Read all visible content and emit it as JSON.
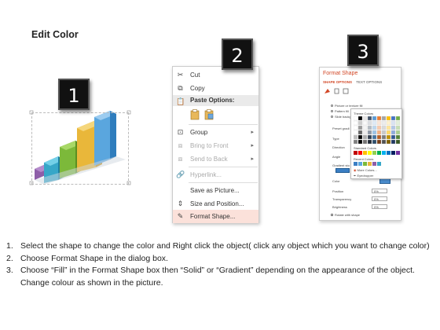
{
  "title": "Edit Color",
  "badges": [
    "1",
    "2",
    "3"
  ],
  "context_menu": {
    "items": [
      {
        "label": "Cut",
        "icon": "scissors-icon",
        "enabled": true
      },
      {
        "label": "Copy",
        "icon": "copy-icon",
        "enabled": true
      },
      {
        "label": "Paste Options:",
        "icon": "paste-icon",
        "enabled": true
      },
      {
        "label": "Group",
        "icon": "group-icon",
        "enabled": true,
        "submenu": true
      },
      {
        "label": "Bring to Front",
        "icon": "bring-to-front-icon",
        "enabled": false,
        "submenu": true
      },
      {
        "label": "Send to Back",
        "icon": "send-to-back-icon",
        "enabled": false,
        "submenu": true
      },
      {
        "label": "Hyperlink...",
        "icon": "hyperlink-icon",
        "enabled": false
      },
      {
        "label": "Save as Picture...",
        "icon": "",
        "enabled": true
      },
      {
        "label": "Size and Position...",
        "icon": "size-position-icon",
        "enabled": true
      },
      {
        "label": "Format Shape...",
        "icon": "format-shape-icon",
        "enabled": true,
        "highlighted": true
      }
    ]
  },
  "format_pane": {
    "title": "Format Shape",
    "tabs": [
      "SHAPE OPTIONS",
      "TEXT OPTIONS"
    ],
    "fill_options": [
      "Picture or texture fill",
      "Pattern fill",
      "Slide backg"
    ],
    "labels": [
      "Preset gradi",
      "Type",
      "Direction",
      "Angle",
      "Gradient sto"
    ],
    "color_label": "Color",
    "position_label": "Position",
    "position_value": "0%",
    "transparency_label": "Transparency",
    "transparency_value": "0%",
    "brightness_label": "Brightness",
    "brightness_value": "0%",
    "rotate_label": "Rotate with shape",
    "palette": {
      "theme_label": "Theme Colors",
      "standard_label": "Standard Colors",
      "recent_label": "Recent Colors",
      "more_label": "More Colors...",
      "eyedropper_label": "Eyedropper"
    }
  },
  "steps": [
    {
      "num": "1.",
      "text": "Select the shape to change the color and Right click the object( click any object which you want to change color)"
    },
    {
      "num": "2.",
      "text": "Choose Format Shape in the dialog box."
    },
    {
      "num": "3.",
      "text": "Choose “Fill” in the Format Shape box then “Solid” or “Gradient” depending on the appearance of the object. Change colour as shown in the picture."
    }
  ],
  "colors": {
    "accent": "#d24726",
    "highlight": "#fbe1da",
    "badge": "#111111"
  }
}
